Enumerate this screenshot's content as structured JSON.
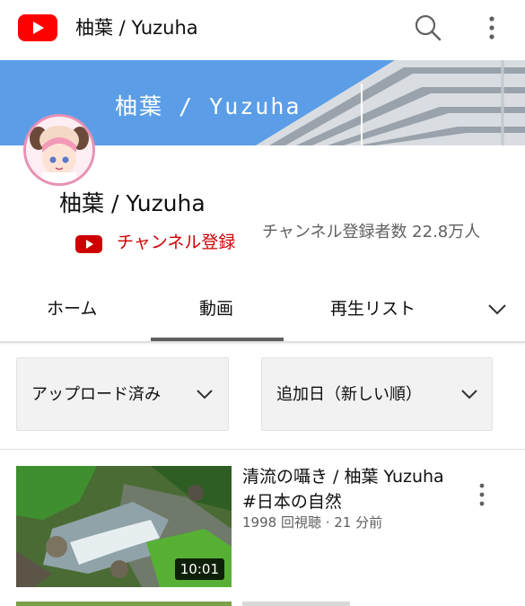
{
  "header": {
    "title": "柚葉 / Yuzuha",
    "logo_icon": "youtube-logo-icon",
    "search_icon": "search-icon",
    "menu_icon": "more-vert-icon",
    "brand_color": "#ff0000"
  },
  "banner": {
    "text": "柚葉 / Yuzuha",
    "background_color": "#5b9ee7"
  },
  "channel": {
    "name": "柚葉 / Yuzuha",
    "subscribe_label": "チャンネル登録",
    "subscriber_count": "チャンネル登録者数 22.8万人",
    "subscribe_color": "#cc0000"
  },
  "tabs": {
    "items": [
      {
        "label": "ホーム"
      },
      {
        "label": "動画"
      },
      {
        "label": "再生リスト"
      }
    ],
    "selected": "動画",
    "more_icon": "chevron-down-icon"
  },
  "filters": {
    "uploaded": "アップロード済み",
    "sort": "追加日（新しい順）"
  },
  "videos": [
    {
      "title": "清流の囁き / 柚葉 Yuzuha　#日本の自然",
      "meta": "1998 回視聴 · 21 分前",
      "duration": "10:01"
    }
  ]
}
